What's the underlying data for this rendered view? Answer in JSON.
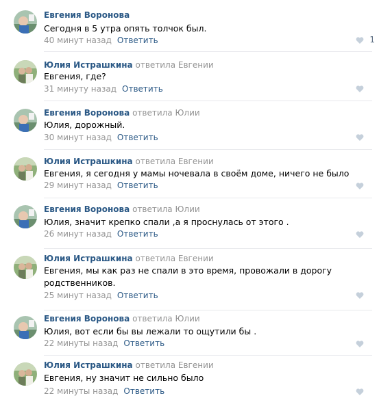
{
  "comments": [
    {
      "author": "Евгения Воронова",
      "reply_to": "",
      "text": "Сегодня в 5 утра опять толчок был.",
      "time": "40 минут назад",
      "reply": "Ответить",
      "likes": "1",
      "avatar": "avatar-evgenia"
    },
    {
      "author": "Юлия Истрашкина",
      "reply_to": "ответила Евгении",
      "text": "Евгения, где?",
      "time": "31 минуту назад",
      "reply": "Ответить",
      "likes": "",
      "avatar": "avatar-yulia"
    },
    {
      "author": "Евгения Воронова",
      "reply_to": "ответила Юлии",
      "text": "Юлия, дорожный.",
      "time": "30 минут назад",
      "reply": "Ответить",
      "likes": "",
      "avatar": "avatar-evgenia"
    },
    {
      "author": "Юлия Истрашкина",
      "reply_to": "ответила Евгении",
      "text": "Евгения, я сегодня у мамы ночевала в своём доме, ничего не было",
      "time": "29 минут назад",
      "reply": "Ответить",
      "likes": "",
      "avatar": "avatar-yulia"
    },
    {
      "author": "Евгения Воронова",
      "reply_to": "ответила Юлии",
      "text": "Юлия, значит крепко спали ,а я проснулась от этого .",
      "time": "26 минут назад",
      "reply": "Ответить",
      "likes": "",
      "avatar": "avatar-evgenia"
    },
    {
      "author": "Юлия Истрашкина",
      "reply_to": "ответила Евгении",
      "text": "Евгения, мы как раз не спали в это время, провожали в дорогу родственников.",
      "time": "25 минут назад",
      "reply": "Ответить",
      "likes": "",
      "avatar": "avatar-yulia"
    },
    {
      "author": "Евгения Воронова",
      "reply_to": "ответила Юлии",
      "text": "Юлия, вот если бы вы лежали то ощутили бы .",
      "time": "22 минуты назад",
      "reply": "Ответить",
      "likes": "",
      "avatar": "avatar-evgenia"
    },
    {
      "author": "Юлия Истрашкина",
      "reply_to": "ответила Евгении",
      "text": "Евгения, ну значит не сильно было",
      "time": "22 минуты назад",
      "reply": "Ответить",
      "likes": "",
      "avatar": "avatar-yulia"
    }
  ],
  "colors": {
    "link": "#2a5885",
    "meta": "#939393",
    "like_icon": "#c5d0db",
    "divider": "#e7e8ec"
  },
  "icons": {
    "like": "heart-icon"
  }
}
